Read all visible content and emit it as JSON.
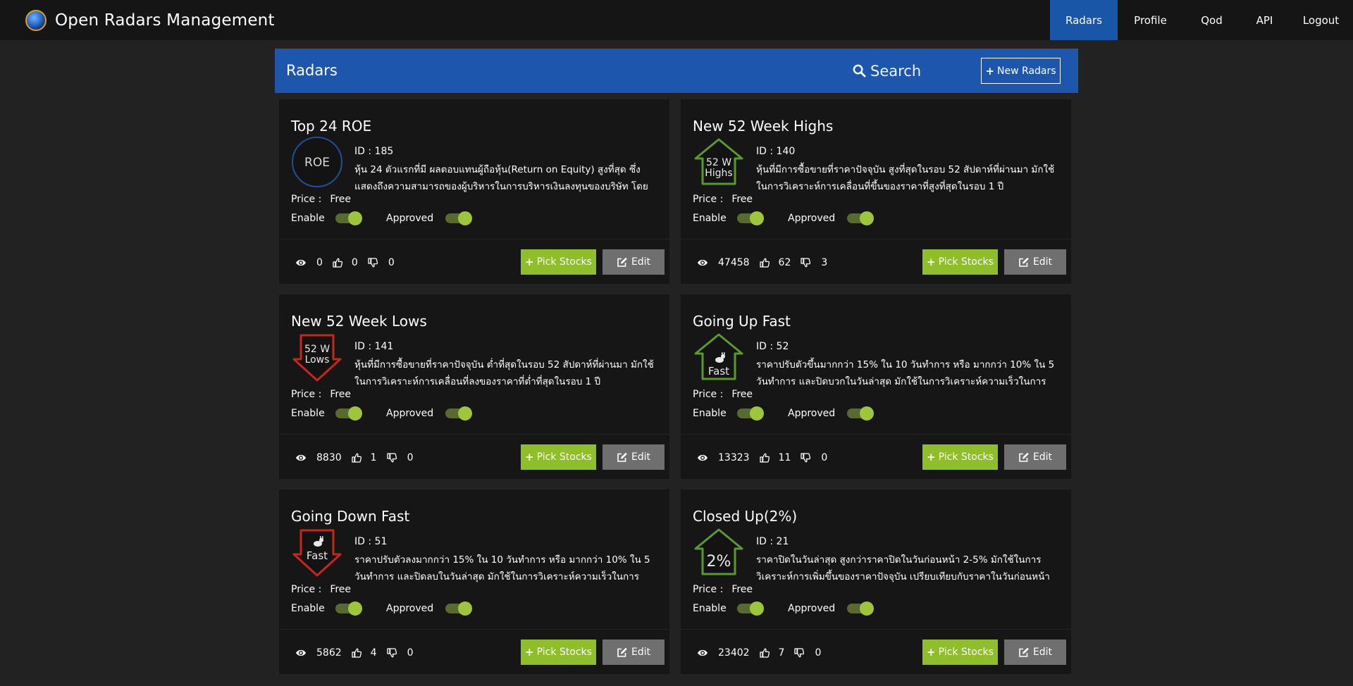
{
  "app": {
    "title": "Open Radars Management"
  },
  "nav": [
    {
      "label": "Radars",
      "active": true
    },
    {
      "label": "Profile",
      "active": false
    },
    {
      "label": "Qod",
      "active": false
    },
    {
      "label": "API",
      "active": false
    },
    {
      "label": "Logout",
      "active": false
    }
  ],
  "panel": {
    "title": "Radars",
    "search_label": "Search",
    "new_button": "New Radars"
  },
  "labels": {
    "id_prefix": "ID : ",
    "price": "Price :",
    "enable": "Enable",
    "approved": "Approved",
    "pick_stocks": "Pick Stocks",
    "edit": "Edit"
  },
  "colors": {
    "accent": "#1c57ad",
    "pick_green": "#8fbe2b",
    "toggle_on": "#9dc63b",
    "up_green": "#5a9a2a",
    "down_red": "#c9251f"
  },
  "cards": [
    {
      "title": "Top 24 ROE",
      "icon": "roe-circle-icon",
      "icon_text": [
        "ROE"
      ],
      "id": "185",
      "description": "หุ้น 24 ตัวแรกที่มี ผลตอบแทนผู้ถือหุ้น(Return on Equity) สูงที่สุด ซึ่งแสดงถึงความสามารถของผู้บริหารในการบริหารเงินลงทุนของบริษัท โดยใช้",
      "price": "Free",
      "enable": true,
      "approved": true,
      "views": "0",
      "likes": "0",
      "dislikes": "0"
    },
    {
      "title": "New 52 Week Highs",
      "icon": "up-arrow-house-icon",
      "icon_text": [
        "52 W",
        "Highs"
      ],
      "id": "140",
      "description": "หุ้นที่มีการซื้อขายที่ราคาปัจจุบัน สูงที่สุดในรอบ 52 สัปดาห์ที่ผ่านมา มักใช้ในการวิเคราะห์การเคลื่อนที่ขึ้นของราคาที่สูงที่สุดในรอบ 1 ปี",
      "price": "Free",
      "enable": true,
      "approved": true,
      "views": "47458",
      "likes": "62",
      "dislikes": "3"
    },
    {
      "title": "New 52 Week Lows",
      "icon": "down-arrow-icon",
      "icon_text": [
        "52 W",
        "Lows"
      ],
      "id": "141",
      "description": "หุ้นที่มีการซื้อขายที่ราคาปัจจุบัน ต่ำที่สุดในรอบ 52 สัปดาห์ที่ผ่านมา มักใช้ในการวิเคราะห์การเคลื่อนที่ลงของราคาที่ต่ำที่สุดในรอบ 1 ปี",
      "price": "Free",
      "enable": true,
      "approved": true,
      "views": "8830",
      "likes": "1",
      "dislikes": "0"
    },
    {
      "title": "Going Up Fast",
      "icon": "up-arrow-rabbit-icon",
      "icon_text": [
        "Fast"
      ],
      "id": "52",
      "description": "ราคาปรับตัวขึ้นมากกว่า 15% ใน 10 วันทำการ หรือ มากกว่า 10% ใน 5 วันทำการ และปิดบวกในวันล่าสุด มักใช้ในการวิเคราะห์ความเร็วในการ",
      "price": "Free",
      "enable": true,
      "approved": true,
      "views": "13323",
      "likes": "11",
      "dislikes": "0"
    },
    {
      "title": "Going Down Fast",
      "icon": "down-arrow-rabbit-icon",
      "icon_text": [
        "Fast"
      ],
      "id": "51",
      "description": "ราคาปรับตัวลงมากกว่า 15% ใน 10 วันทำการ หรือ มากกว่า 10% ใน 5 วันทำการ และปิดลบในวันล่าสุด มักใช้ในการวิเคราะห์ความเร็วในการเคลื่อนที่",
      "price": "Free",
      "enable": true,
      "approved": true,
      "views": "5862",
      "likes": "4",
      "dislikes": "0"
    },
    {
      "title": "Closed Up(2%)",
      "icon": "up-arrow-percent-icon",
      "icon_text": [
        "2%"
      ],
      "id": "21",
      "description": "ราคาปิดในวันล่าสุด สูงกว่าราคาปิดในวันก่อนหน้า 2-5% มักใช้ในการวิเคราะห์การเพิ่มขึ้นของราคาปัจจุบัน เปรียบเทียบกับราคาในวันก่อนหน้า",
      "price": "Free",
      "enable": true,
      "approved": true,
      "views": "23402",
      "likes": "7",
      "dislikes": "0"
    }
  ]
}
